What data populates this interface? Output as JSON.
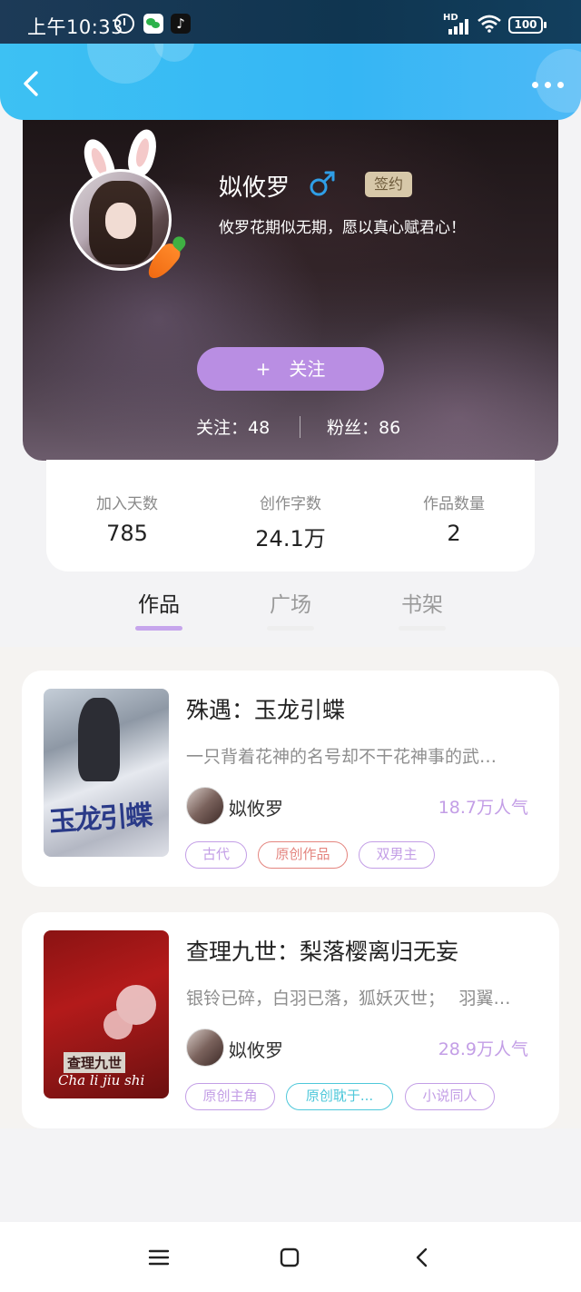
{
  "status_bar": {
    "time": "上午10:33",
    "hd": "HD",
    "battery": "100",
    "tiktok_glyph": "♪",
    "icons": [
      "alarm-icon",
      "wechat-icon",
      "tiktok-icon",
      "signal-icon",
      "wifi-icon",
      "battery-icon"
    ]
  },
  "header": {
    "back_icon": "chevron-left-icon",
    "more_icon": "more-dots-icon",
    "bg_color": "#3dc1f3"
  },
  "profile": {
    "name": "姒攸罗",
    "gender": "male",
    "gender_color": "#2f9ee6",
    "sign_badge": "签约",
    "motto": "攸罗花期似无期，愿以真心赋君心！",
    "follow_button": {
      "plus": "+",
      "label": "关注",
      "color": "#b98ee3"
    },
    "following_label": "关注：48",
    "fans_label": "粉丝：86"
  },
  "stats": [
    {
      "label": "加入天数",
      "value": "785"
    },
    {
      "label": "创作字数",
      "value": "24.1万"
    },
    {
      "label": "作品数量",
      "value": "2"
    }
  ],
  "tabs": [
    {
      "label": "作品",
      "active": true
    },
    {
      "label": "广场",
      "active": false
    },
    {
      "label": "书架",
      "active": false
    }
  ],
  "tab_accent": "#c6a5ec",
  "books": [
    {
      "title": "殊遇：玉龙引蝶",
      "description": "一只背着花神的名号却不干花神事的武…",
      "author": "姒攸罗",
      "popularity": "18.7万人气",
      "cover_text": "玉龙引蝶",
      "tags": [
        {
          "label": "古代",
          "color": "#c39ee6"
        },
        {
          "label": "原创作品",
          "color": "#e4857f"
        },
        {
          "label": "双男主",
          "color": "#c39ee6"
        }
      ]
    },
    {
      "title": "查理九世：梨落樱离归无妄",
      "description": "银铃已碎，白羽已落，狐妖灭世；　 羽翼…",
      "author": "姒攸罗",
      "popularity": "28.9万人气",
      "cover_text": "查理九世",
      "cover_pinyin": "Cha li jiu shi",
      "tags": [
        {
          "label": "原创主角",
          "color": "#c39ee6"
        },
        {
          "label": "原创耽于...",
          "color": "#4fc8da"
        },
        {
          "label": "小说同人",
          "color": "#c39ee6"
        }
      ]
    }
  ],
  "nav": {
    "icons": [
      "menu-icon",
      "home-square-icon",
      "back-icon"
    ]
  }
}
